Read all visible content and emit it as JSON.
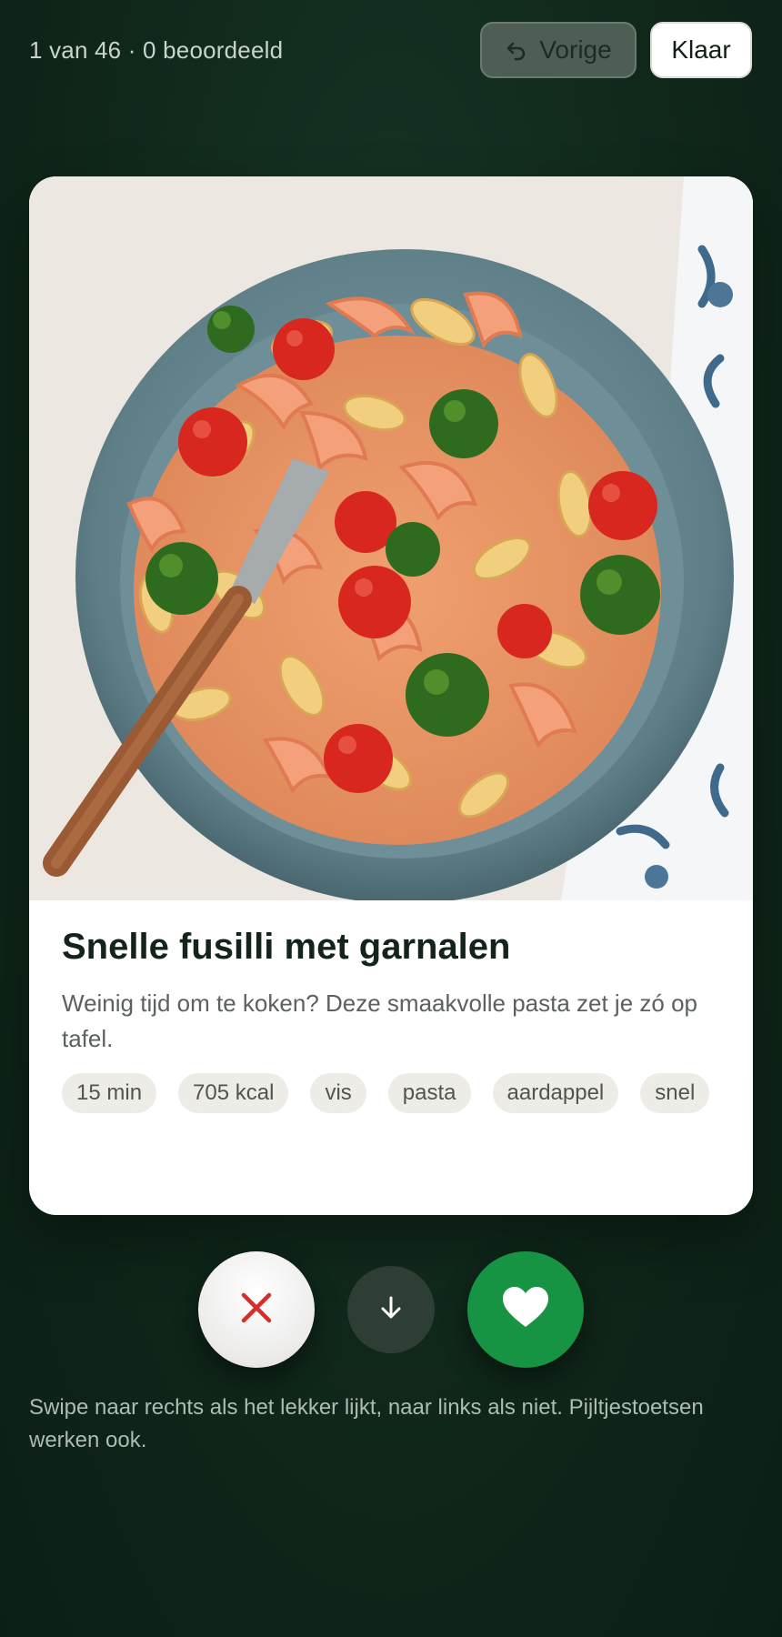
{
  "header": {
    "progress": "1 van 46 · 0 beoordeeld",
    "prev_label": "Vorige",
    "done_label": "Klaar"
  },
  "recipe": {
    "title": "Snelle fusilli met garnalen",
    "description": "Weinig tijd om te koken? Deze smaakvolle pasta zet je zó op tafel.",
    "tags": [
      "15 min",
      "705 kcal",
      "vis",
      "pasta",
      "aardappel",
      "snel"
    ],
    "image_subject": "bowl of fusilli with shrimp, cherry tomatoes and broccoli"
  },
  "actions": {
    "dislike_icon": "close-icon",
    "skip_icon": "arrow-down-icon",
    "like_icon": "heart-icon"
  },
  "hint": "Swipe naar rechts als het lekker lijkt, naar links als niet. Pijltjestoetsen werken ook.",
  "colors": {
    "background": "#0f2619",
    "like": "#169443",
    "dislike_icon": "#d32f2f",
    "skip": "#2f3e35",
    "card": "#ffffff",
    "tag_bg": "#eeece6"
  }
}
